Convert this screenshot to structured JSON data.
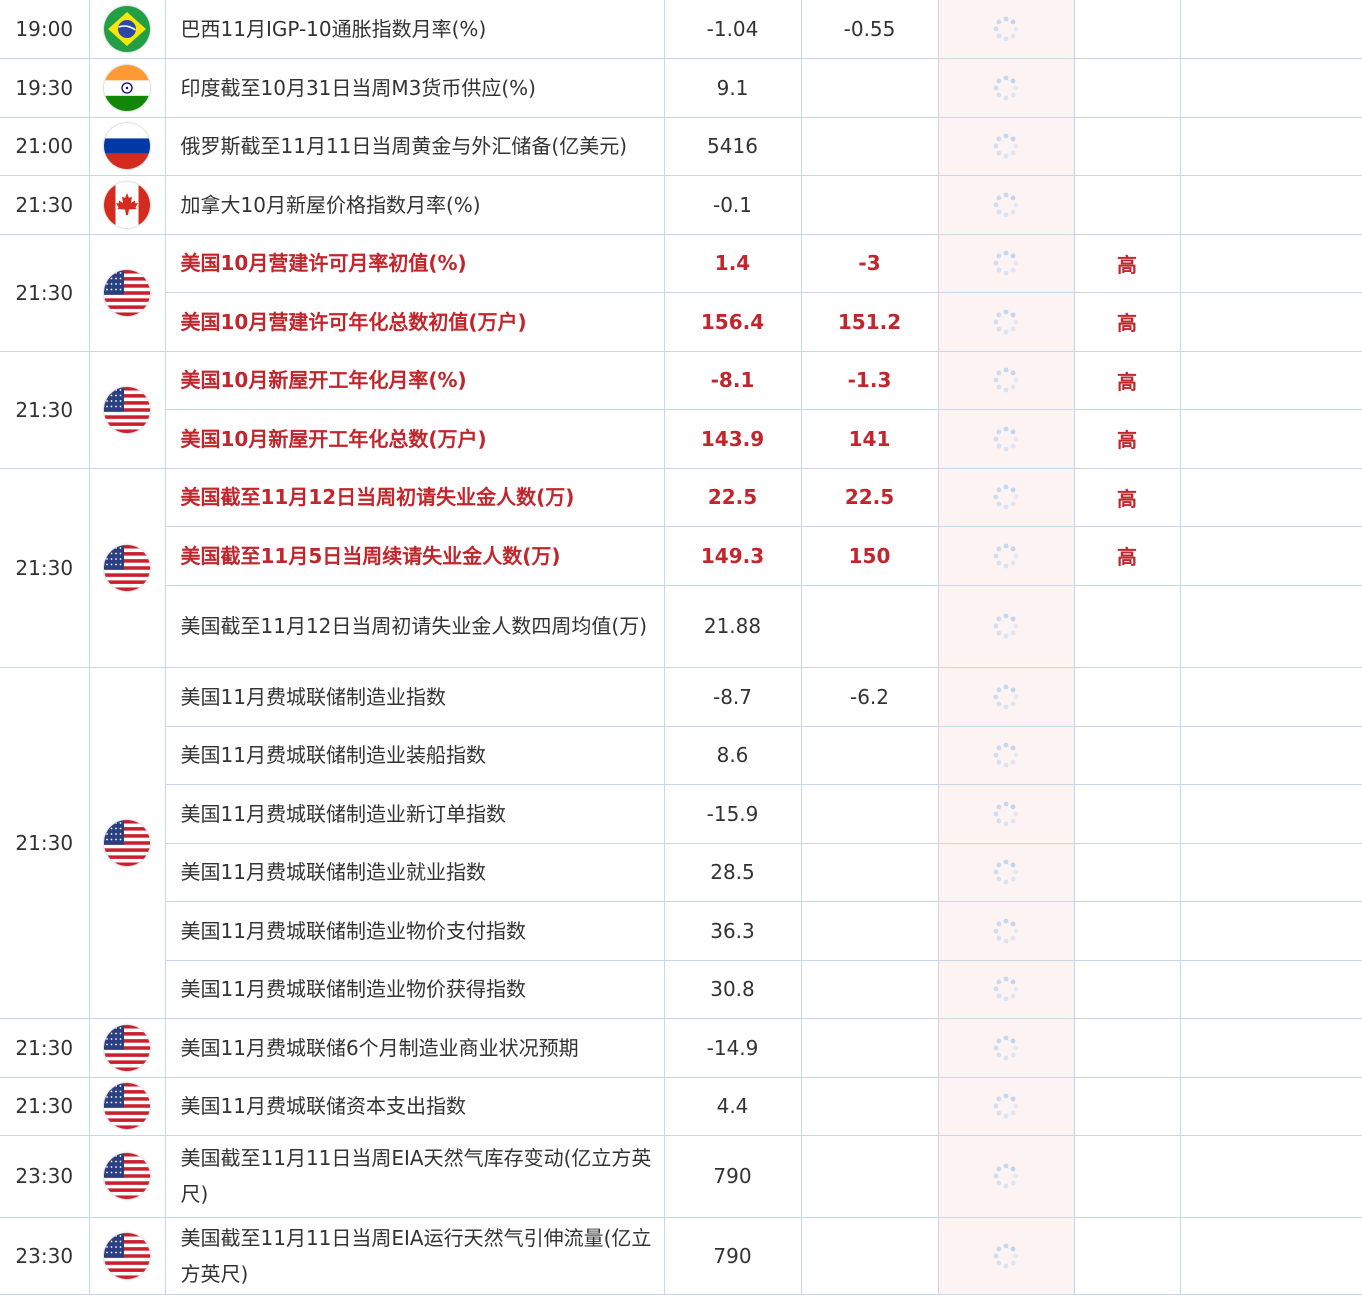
{
  "colors": {
    "important": "#c0262c",
    "border": "#c7d7e8",
    "actual_bg": "#fdf3f3",
    "text": "#333333",
    "spinner": "#b9d3ee"
  },
  "groups": [
    {
      "time": "19:00",
      "flag": "brazil-flag",
      "rows": [
        {
          "event": "巴西11月IGP-10通胀指数月率(%)",
          "previous": "-1.04",
          "forecast": "-0.55",
          "importance": "",
          "important": false,
          "h": 58
        }
      ]
    },
    {
      "time": "19:30",
      "flag": "india-flag",
      "rows": [
        {
          "event": "印度截至10月31日当周M3货币供应(%)",
          "previous": "9.1",
          "forecast": "",
          "importance": "",
          "important": false,
          "h": 59
        }
      ]
    },
    {
      "time": "21:00",
      "flag": "russia-flag",
      "rows": [
        {
          "event": "俄罗斯截至11月11日当周黄金与外汇储备(亿美元)",
          "previous": "5416",
          "forecast": "",
          "importance": "",
          "important": false,
          "h": 58
        }
      ]
    },
    {
      "time": "21:30",
      "flag": "canada-flag",
      "rows": [
        {
          "event": "加拿大10月新屋价格指数月率(%)",
          "previous": "-0.1",
          "forecast": "",
          "importance": "",
          "important": false,
          "h": 59
        }
      ]
    },
    {
      "time": "21:30",
      "flag": "usa-flag",
      "rows": [
        {
          "event": "美国10月营建许可月率初值(%)",
          "previous": "1.4",
          "forecast": "-3",
          "importance": "高",
          "important": true,
          "h": 58
        },
        {
          "event": "美国10月营建许可年化总数初值(万户)",
          "previous": "156.4",
          "forecast": "151.2",
          "importance": "高",
          "important": true,
          "h": 59
        }
      ]
    },
    {
      "time": "21:30",
      "flag": "usa-flag",
      "rows": [
        {
          "event": "美国10月新屋开工年化月率(%)",
          "previous": "-8.1",
          "forecast": "-1.3",
          "importance": "高",
          "important": true,
          "h": 58
        },
        {
          "event": "美国10月新屋开工年化总数(万户)",
          "previous": "143.9",
          "forecast": "141",
          "importance": "高",
          "important": true,
          "h": 59
        }
      ]
    },
    {
      "time": "21:30",
      "flag": "usa-flag",
      "rows": [
        {
          "event": "美国截至11月12日当周初请失业金人数(万)",
          "previous": "22.5",
          "forecast": "22.5",
          "importance": "高",
          "important": true,
          "h": 58
        },
        {
          "event": "美国截至11月5日当周续请失业金人数(万)",
          "previous": "149.3",
          "forecast": "150",
          "importance": "高",
          "important": true,
          "h": 59
        },
        {
          "event": "美国截至11月12日当周初请失业金人数四周均值(万)",
          "previous": "21.88",
          "forecast": "",
          "importance": "",
          "important": false,
          "h": 82
        }
      ]
    },
    {
      "time": "21:30",
      "flag": "usa-flag",
      "rows": [
        {
          "event": "美国11月费城联储制造业指数",
          "previous": "-8.7",
          "forecast": "-6.2",
          "importance": "",
          "important": false,
          "h": 59
        },
        {
          "event": "美国11月费城联储制造业装船指数",
          "previous": "8.6",
          "forecast": "",
          "importance": "",
          "important": false,
          "h": 58
        },
        {
          "event": "美国11月费城联储制造业新订单指数",
          "previous": "-15.9",
          "forecast": "",
          "importance": "",
          "important": false,
          "h": 59
        },
        {
          "event": "美国11月费城联储制造业就业指数",
          "previous": "28.5",
          "forecast": "",
          "importance": "",
          "important": false,
          "h": 58
        },
        {
          "event": "美国11月费城联储制造业物价支付指数",
          "previous": "36.3",
          "forecast": "",
          "importance": "",
          "important": false,
          "h": 59
        },
        {
          "event": "美国11月费城联储制造业物价获得指数",
          "previous": "30.8",
          "forecast": "",
          "importance": "",
          "important": false,
          "h": 58
        }
      ]
    },
    {
      "time": "21:30",
      "flag": "usa-flag",
      "rows": [
        {
          "event": "美国11月费城联储6个月制造业商业状况预期",
          "previous": "-14.9",
          "forecast": "",
          "importance": "",
          "important": false,
          "h": 59
        }
      ]
    },
    {
      "time": "21:30",
      "flag": "usa-flag",
      "rows": [
        {
          "event": "美国11月费城联储资本支出指数",
          "previous": "4.4",
          "forecast": "",
          "importance": "",
          "important": false,
          "h": 58
        }
      ]
    },
    {
      "time": "23:30",
      "flag": "usa-flag",
      "rows": [
        {
          "event": "美国截至11月11日当周EIA天然气库存变动(亿立方英尺)",
          "previous": "790",
          "forecast": "",
          "importance": "",
          "important": false,
          "h": 82
        }
      ]
    },
    {
      "time": "23:30",
      "flag": "usa-flag",
      "rows": [
        {
          "event": "美国截至11月11日当周EIA运行天然气引伸流量(亿立方英尺)",
          "previous": "790",
          "forecast": "",
          "importance": "",
          "important": false,
          "h": 77
        }
      ]
    }
  ]
}
